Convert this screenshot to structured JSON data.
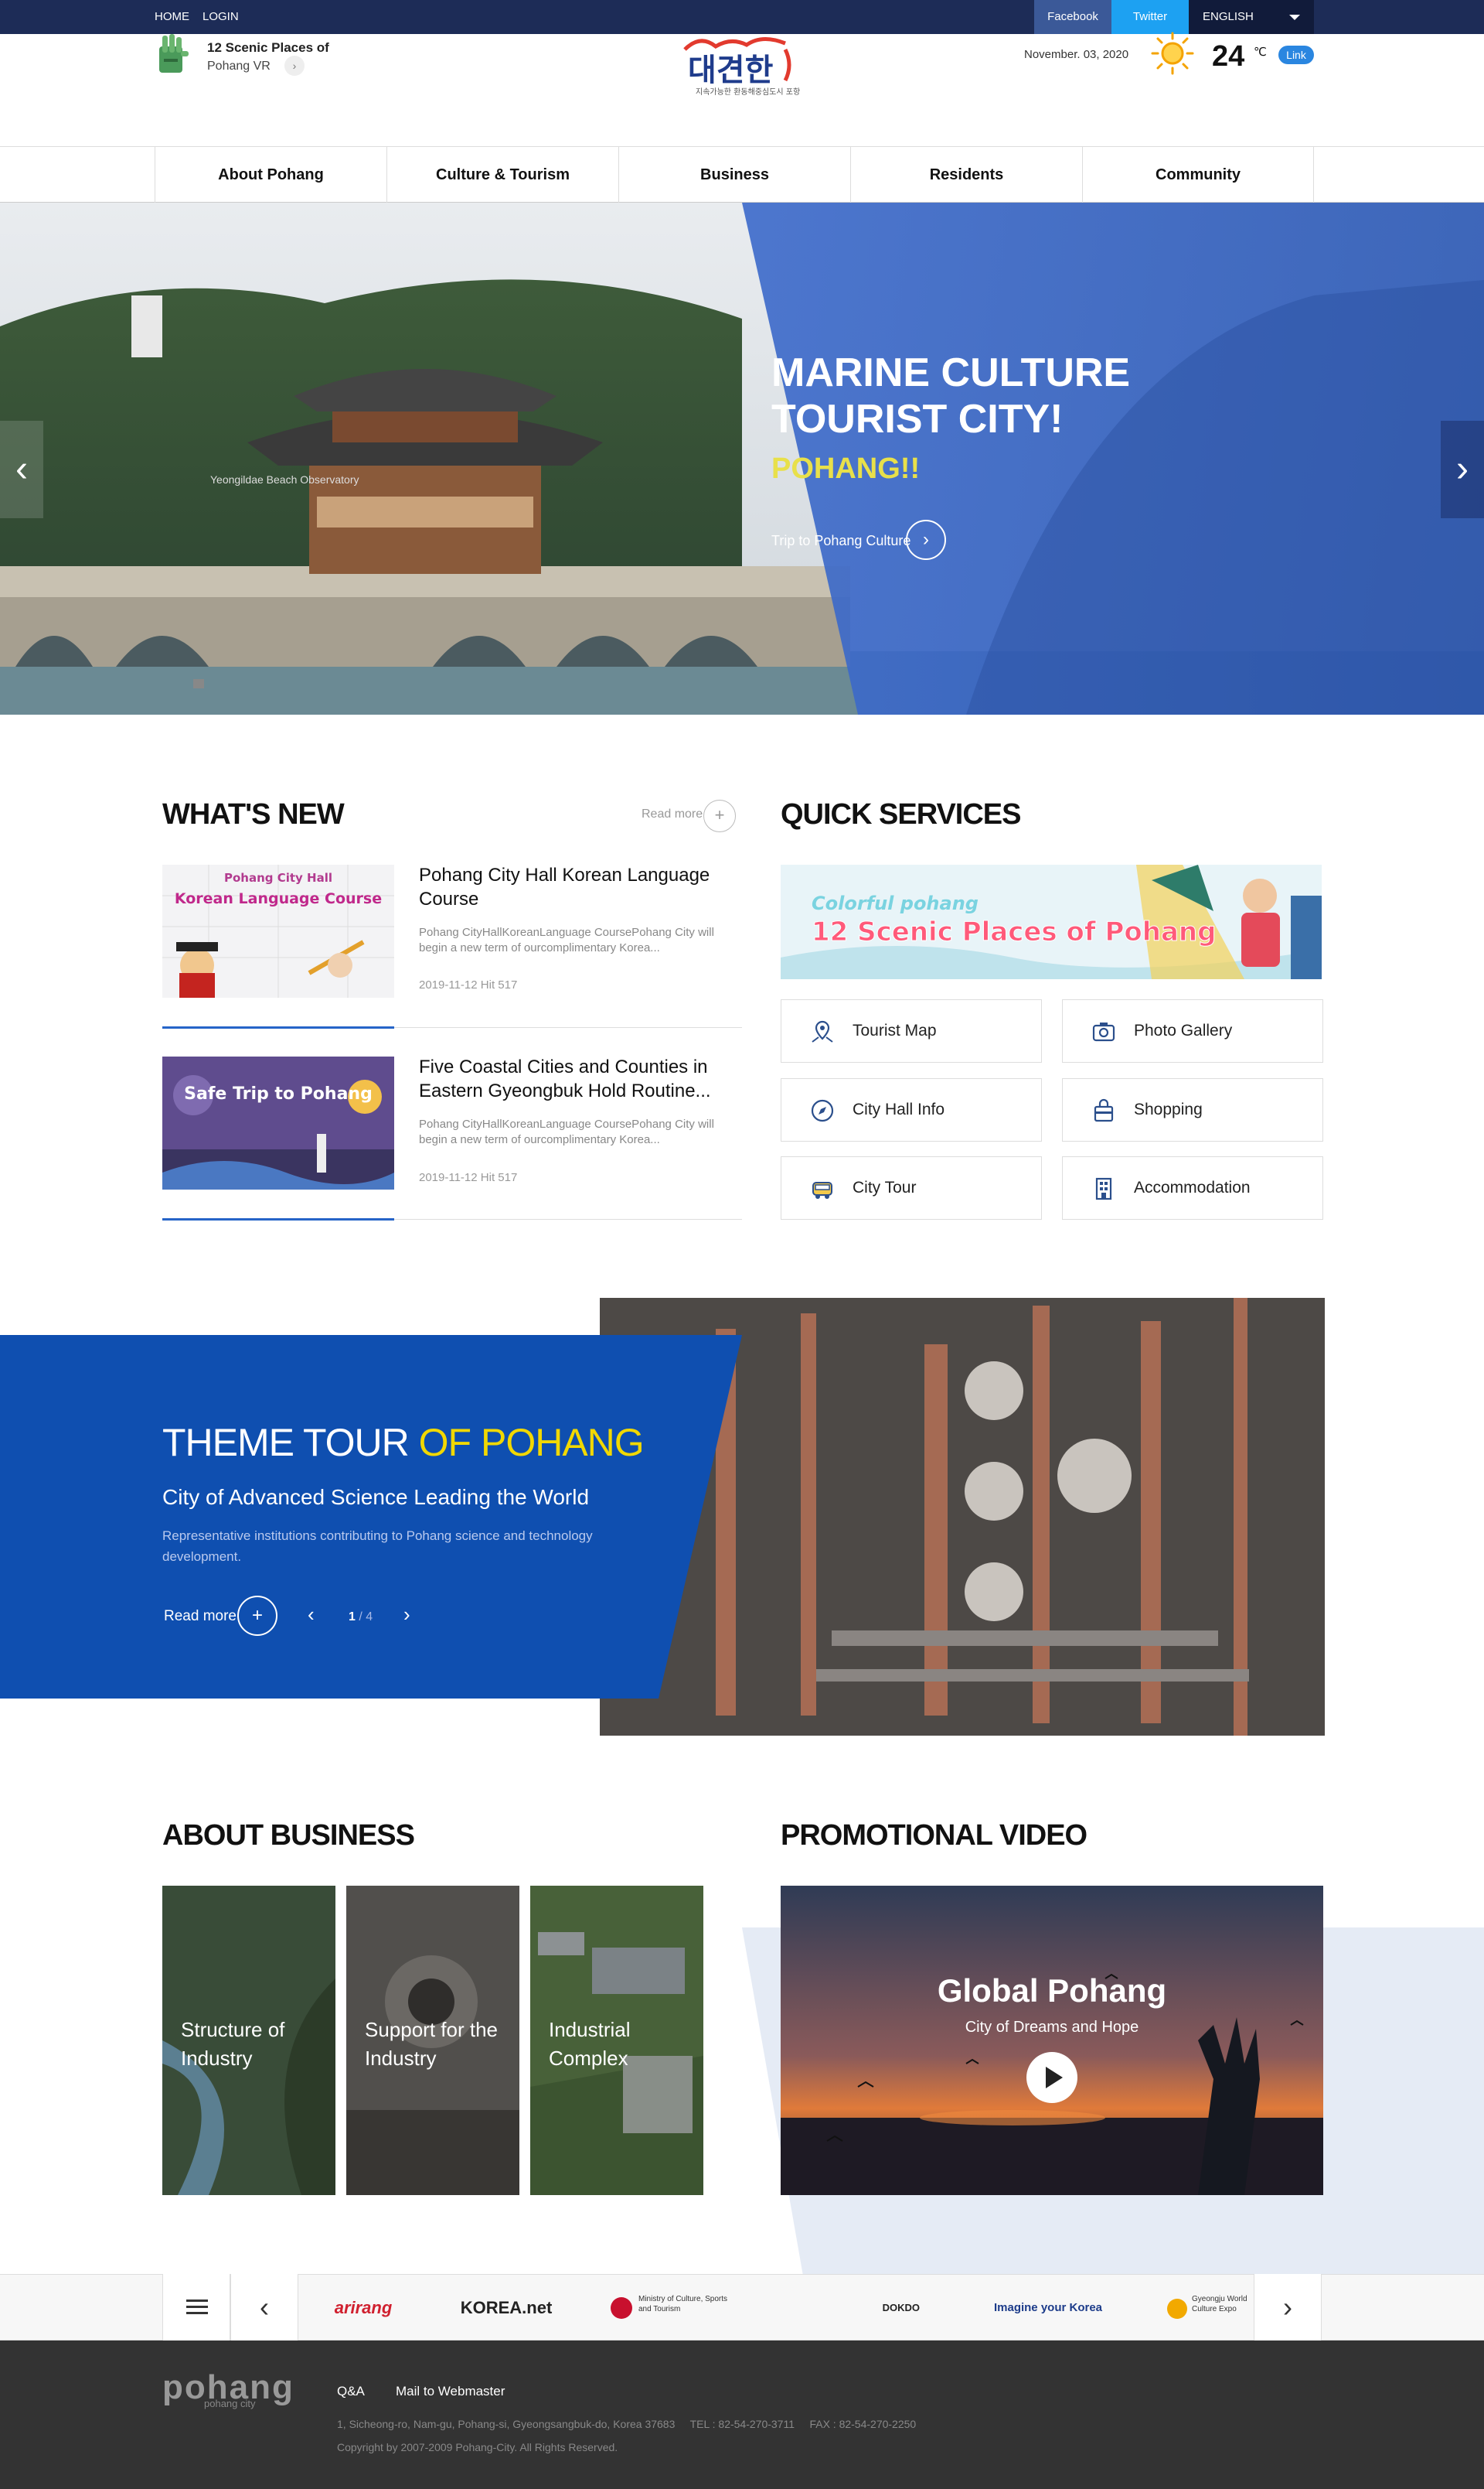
{
  "topbar": {
    "home": "HOME",
    "login": "LOGIN",
    "facebook": "Facebook",
    "twitter": "Twitter",
    "language": "ENGLISH"
  },
  "header": {
    "vr_title": "12 Scenic Places of",
    "vr_sub": "Pohang VR",
    "logo_text": "대견한",
    "logo_sub": "지속가능한 환동해중심도시 포항",
    "date": "November. 03, 2020",
    "temperature": "24",
    "temp_unit": "℃",
    "weather_link": "Link"
  },
  "nav": [
    "About Pohang",
    "Culture & Tourism",
    "Business",
    "Residents",
    "Community"
  ],
  "hero": {
    "title": "MARINE CULTURE TOURIST CITY!",
    "subtitle": "POHANG!!",
    "cta": "Trip to Pohang Culture",
    "caption": "Yeongildae Beach Observatory"
  },
  "whats_new": {
    "title": "WHAT'S NEW",
    "read_more": "Read more",
    "items": [
      {
        "title": "Pohang City Hall Korean Language Course",
        "desc": "Pohang CityHallKoreanLanguage CoursePohang City will begin a new term of ourcomplimentary Korea...",
        "meta": "2019-11-12  Hit 517",
        "thumb_label_top": "Pohang City Hall",
        "thumb_label_main": "Korean Language Course"
      },
      {
        "title": "Five Coastal Cities and Counties in Eastern Gyeongbuk Hold Routine...",
        "desc": "Pohang CityHallKoreanLanguage CoursePohang City will begin a new term of ourcomplimentary Korea...",
        "meta": "2019-11-12  Hit 517",
        "thumb_label_main": "Safe Trip to Pohang"
      }
    ]
  },
  "quick_services": {
    "title": "QUICK SERVICES",
    "banner_small": "Colorful pohang",
    "banner_big": "12 Scenic Places of Pohang",
    "buttons": [
      "Tourist Map",
      "Photo Gallery",
      "City Hall Info",
      "Shopping",
      "City Tour",
      "Accommodation"
    ]
  },
  "theme_tour": {
    "title_a": "THEME TOUR ",
    "title_b": "OF POHANG",
    "subtitle": "City of Advanced Science Leading the World",
    "desc": "Representative institutions contributing to Pohang science and technology development.",
    "read_more": "Read more",
    "page_current": "1",
    "page_total": " / 4"
  },
  "about_business": {
    "title": "ABOUT BUSINESS",
    "cards": [
      "Structure of Industry",
      "Support for the Industry",
      "Industrial Complex"
    ]
  },
  "promo": {
    "title": "PROMOTIONAL VIDEO",
    "video_title": "Global Pohang",
    "video_sub": "City of Dreams and Hope"
  },
  "partners": [
    "arirang",
    "KOREA.net",
    "Ministry of Culture, Sports and Tourism",
    "DOKDO",
    "Imagine your Korea",
    "Gyeongju World Culture Expo"
  ],
  "footer": {
    "logo": "pohang",
    "logo_sub": "pohang city",
    "links": [
      "Q&A",
      "Mail to Webmaster"
    ],
    "address": "1, Sicheong-ro, Nam-gu, Pohang-si, Gyeongsangbuk-do, Korea 37683     TEL : 82-54-270-3711     FAX : 82-54-270-2250",
    "copyright": "Copyright by 2007-2009 Pohang-City. All Rights Reserved."
  },
  "colors": {
    "topbar": "#1d2c57",
    "accent_blue": "#0f4fb0",
    "hero_blue": "#3a68c4",
    "yellow": "#f1d800",
    "footer": "#333333"
  }
}
